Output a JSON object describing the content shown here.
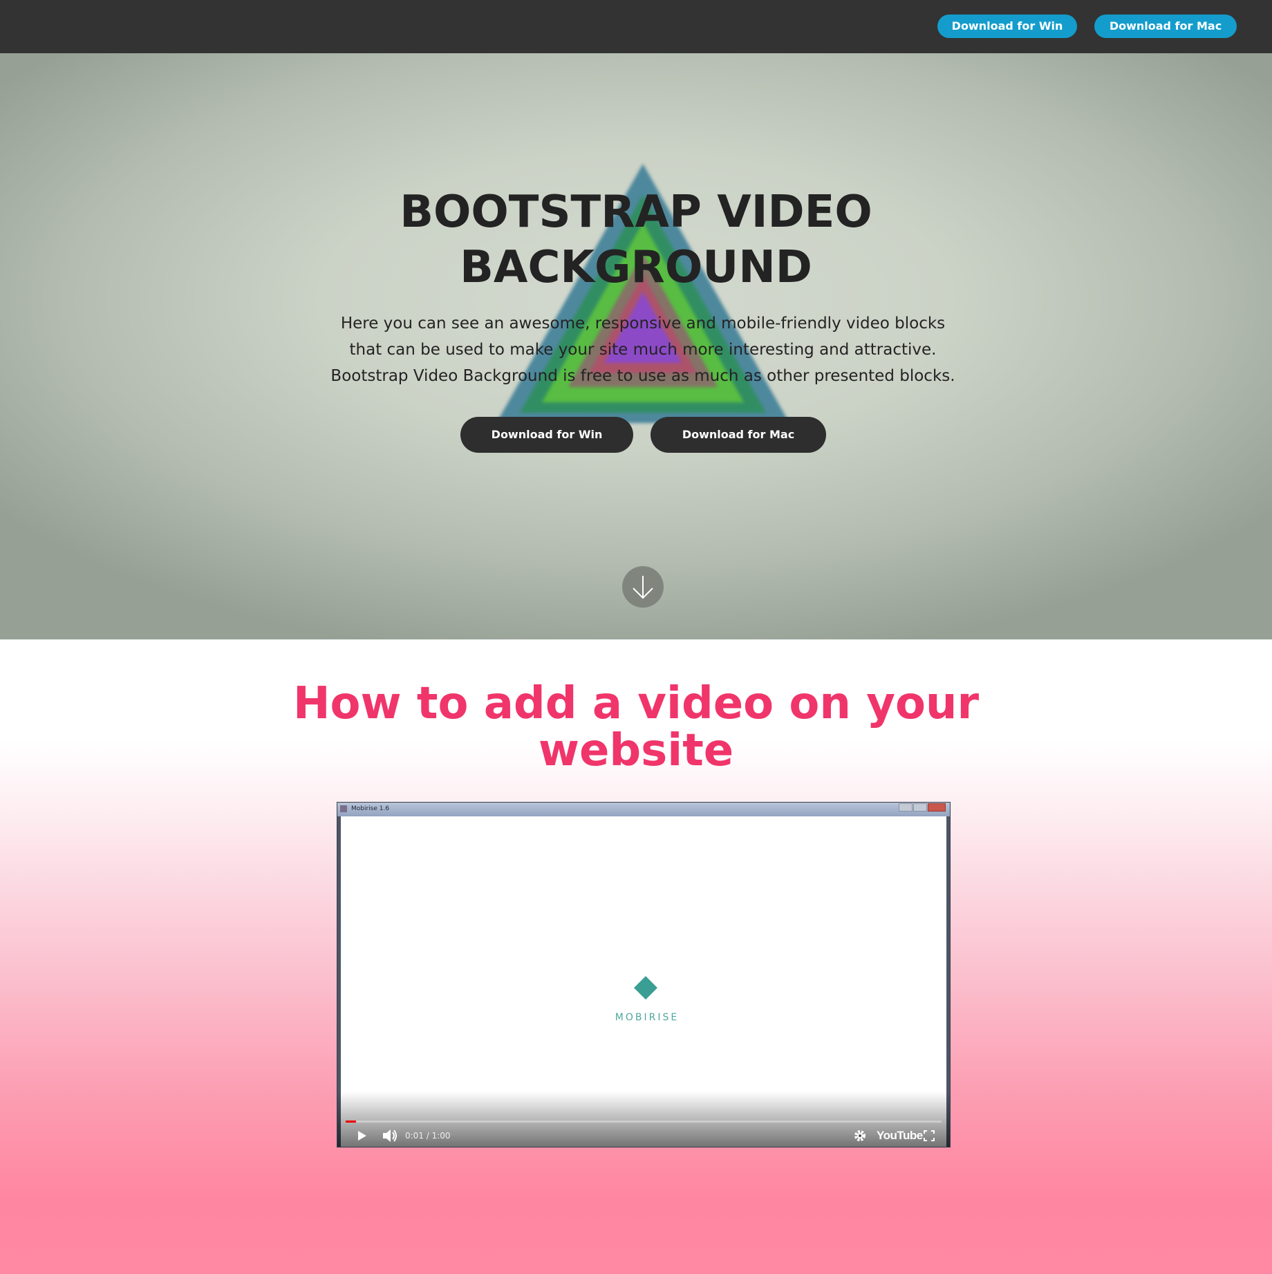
{
  "navbar": {
    "download_win": "Download for Win",
    "download_mac": "Download for Mac",
    "button_color": "#149dcc"
  },
  "hero": {
    "title": "BOOTSTRAP VIDEO BACKGROUND",
    "text": "Here you can see an awesome, responsive and mobile-friendly video blocks that can be used to make your site much more interesting and attractive. Bootstrap Video Background is free to use as much as other presented blocks.",
    "download_win": "Download for Win",
    "download_mac": "Download for Mac",
    "scroll_icon": "arrow-down-icon"
  },
  "section2": {
    "title": "How to add a video on your website",
    "title_color": "#f0356b"
  },
  "video": {
    "window_title": "Mobirise 1.6",
    "logo_text": "MOBIRISE",
    "time": "0:01 / 1:00",
    "progress_fraction": 0.017,
    "brand": "YouTube",
    "icons": [
      "play-icon",
      "volume-icon",
      "gear-icon",
      "fullscreen-icon"
    ]
  }
}
